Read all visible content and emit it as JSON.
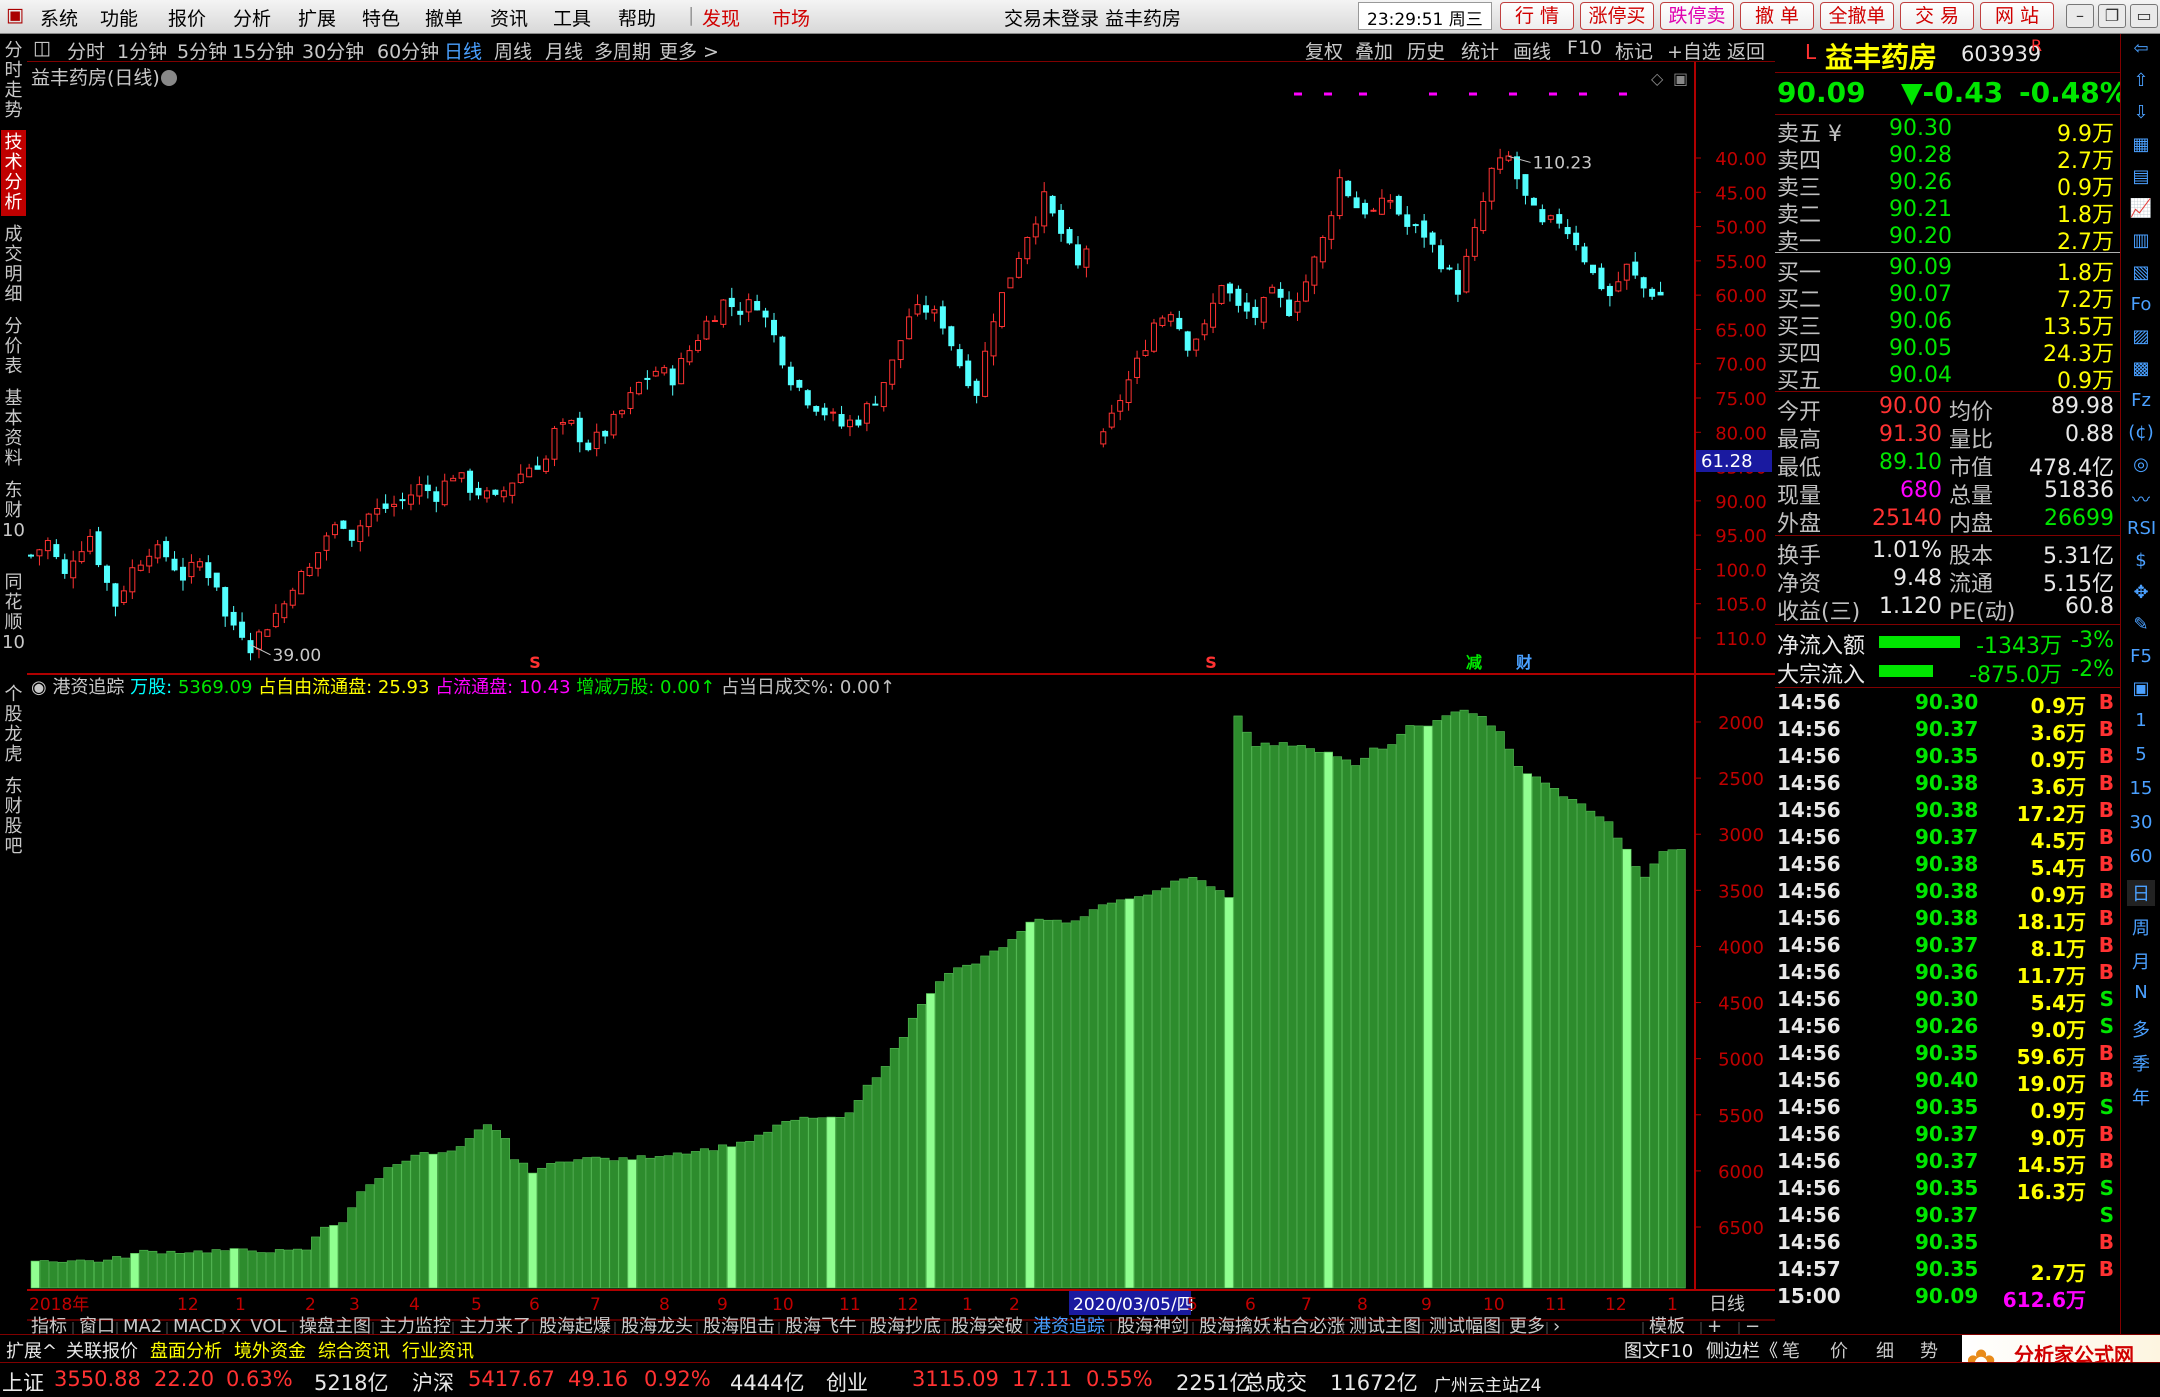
{
  "menu": {
    "items": [
      "系统",
      "功能",
      "报价",
      "分析",
      "扩展",
      "特色",
      "撤单",
      "资讯",
      "工具",
      "帮助"
    ],
    "highlight_items": [
      "发现",
      "市场"
    ],
    "title": "交易未登录  益丰药房",
    "clock": "23:29:51 周三",
    "right_buttons": [
      "行 情",
      "涨停买",
      "跌停卖",
      "撤 单",
      "全撤单",
      "交 易",
      "网 站"
    ]
  },
  "left_tabs": [
    {
      "label": "分时走势",
      "active": false
    },
    {
      "label": "技术分析",
      "active": true
    },
    {
      "label": "成交明细",
      "active": false
    },
    {
      "label": "分价表",
      "active": false
    },
    {
      "label": "基本资料",
      "active": false
    },
    {
      "label": "东财10",
      "active": false
    },
    {
      "label": "同花顺10",
      "active": false
    },
    {
      "label": "个股龙虎",
      "active": false
    },
    {
      "label": "东财股吧",
      "active": false
    }
  ],
  "period_tabs": {
    "items": [
      "分时",
      "1分钟",
      "5分钟",
      "15分钟",
      "30分钟",
      "60分钟",
      "日线",
      "周线",
      "月线",
      "多周期",
      "更多 >"
    ],
    "active": "日线",
    "right_items": [
      "复权",
      "叠加",
      "历史",
      "统计",
      "画线",
      "F10",
      "标记",
      "+自选",
      "返回"
    ]
  },
  "chart": {
    "title": "益丰药房(日线)",
    "high_label": "110.23",
    "low_label": "39.00",
    "cursor_price": "61.28",
    "y_ticks": [
      "110.0",
      "105.0",
      "100.0",
      "95.00",
      "90.00",
      "85.00",
      "80.00",
      "75.00",
      "70.00",
      "65.00",
      "60.00",
      "55.00",
      "50.00",
      "45.00",
      "40.00"
    ],
    "event_marks": [
      {
        "text": "S",
        "color": "#ff3232"
      },
      {
        "text": "S",
        "color": "#ff3232"
      },
      {
        "text": "减",
        "color": "#00e600"
      },
      {
        "text": "财",
        "color": "#4aa0ff"
      }
    ],
    "indicator": {
      "name": "港资追踪",
      "fields": [
        {
          "label": "万股:",
          "value": "5369.09",
          "lc": "#00ffff",
          "vc": "#00e600"
        },
        {
          "label": "占自由流通盘:",
          "value": "25.93",
          "lc": "#ffff00",
          "vc": "#ffff00"
        },
        {
          "label": "占流通盘:",
          "value": "10.43",
          "lc": "#ff00ff",
          "vc": "#ff00ff"
        },
        {
          "label": "增减万股:",
          "value": "0.00",
          "lc": "#00e600",
          "vc": "#00e600"
        },
        {
          "label": "占当日成交%:",
          "value": "0.00",
          "lc": "#c0c0c0",
          "vc": "#c0c0c0"
        }
      ],
      "y_ticks": [
        "6500",
        "6000",
        "5500",
        "5000",
        "4500",
        "4000",
        "3500",
        "3000",
        "2500",
        "2000"
      ]
    },
    "x_labels": [
      "2018年",
      "12",
      "1",
      "2",
      "3",
      "4",
      "5",
      "6",
      "7",
      "8",
      "9",
      "10",
      "11",
      "12",
      "1",
      "2",
      "2020/03/05/四",
      "5",
      "6",
      "7",
      "8",
      "9",
      "10",
      "11",
      "12",
      "1"
    ],
    "x_right_label": "日线"
  },
  "chart_data": [
    {
      "type": "candlestick",
      "title": "益丰药房(日线)",
      "ylim": [
        39,
        111
      ],
      "y_ticks": [
        40,
        45,
        50,
        55,
        60,
        65,
        70,
        75,
        80,
        85,
        90,
        95,
        100,
        105,
        110
      ],
      "close_path": [
        [
          0,
          52
        ],
        [
          2,
          54
        ],
        [
          4,
          49
        ],
        [
          5,
          52
        ],
        [
          7,
          55
        ],
        [
          9,
          48
        ],
        [
          10,
          45
        ],
        [
          12,
          50
        ],
        [
          14,
          53
        ],
        [
          16,
          52
        ],
        [
          18,
          49
        ],
        [
          20,
          51
        ],
        [
          22,
          48
        ],
        [
          23,
          43
        ],
        [
          25,
          41
        ],
        [
          26,
          39
        ],
        [
          28,
          42
        ],
        [
          30,
          45
        ],
        [
          31,
          48
        ],
        [
          33,
          50
        ],
        [
          35,
          55
        ],
        [
          37,
          57
        ],
        [
          38,
          55
        ],
        [
          40,
          58
        ],
        [
          42,
          59
        ],
        [
          44,
          60
        ],
        [
          46,
          62
        ],
        [
          48,
          61
        ],
        [
          50,
          64
        ],
        [
          52,
          62
        ],
        [
          55,
          60
        ],
        [
          57,
          63
        ],
        [
          59,
          65
        ],
        [
          61,
          66
        ],
        [
          62,
          70
        ],
        [
          64,
          71
        ],
        [
          66,
          68
        ],
        [
          68,
          70
        ],
        [
          70,
          73
        ],
        [
          72,
          77
        ],
        [
          74,
          79
        ],
        [
          76,
          78
        ],
        [
          78,
          82
        ],
        [
          80,
          86
        ],
        [
          82,
          89
        ],
        [
          84,
          88
        ],
        [
          86,
          89
        ],
        [
          88,
          84
        ],
        [
          90,
          78
        ],
        [
          92,
          75
        ],
        [
          94,
          73
        ],
        [
          96,
          71
        ],
        [
          98,
          72
        ],
        [
          100,
          75
        ],
        [
          102,
          80
        ],
        [
          104,
          87
        ],
        [
          106,
          88
        ],
        [
          108,
          86
        ],
        [
          110,
          80
        ],
        [
          112,
          76
        ],
        [
          114,
          87
        ],
        [
          116,
          93
        ],
        [
          118,
          99
        ],
        [
          120,
          104
        ],
        [
          122,
          99
        ],
        [
          124,
          94
        ],
        [
          125,
          97
        ]
      ],
      "gap_after_index": 125,
      "close_path_2": [
        [
          127,
          69
        ],
        [
          129,
          75
        ],
        [
          131,
          80
        ],
        [
          133,
          86
        ],
        [
          135,
          88
        ],
        [
          137,
          83
        ],
        [
          139,
          85
        ],
        [
          141,
          92
        ],
        [
          143,
          88
        ],
        [
          145,
          87
        ],
        [
          147,
          90
        ],
        [
          149,
          88
        ],
        [
          151,
          92
        ],
        [
          153,
          98
        ],
        [
          155,
          107
        ],
        [
          157,
          103
        ],
        [
          159,
          102
        ],
        [
          161,
          104
        ],
        [
          163,
          100
        ],
        [
          165,
          99
        ],
        [
          167,
          95
        ],
        [
          169,
          91
        ],
        [
          171,
          99
        ],
        [
          173,
          108
        ],
        [
          175,
          110
        ],
        [
          177,
          104
        ],
        [
          179,
          100
        ],
        [
          181,
          101
        ],
        [
          183,
          98
        ],
        [
          185,
          93
        ],
        [
          187,
          90
        ],
        [
          189,
          94
        ],
        [
          191,
          91
        ],
        [
          193,
          90
        ]
      ],
      "note_high": 110.23,
      "note_low": 39.0
    },
    {
      "type": "bar",
      "title": "港资追踪",
      "series_name": "万股",
      "ylim": [
        1600,
        6750
      ],
      "y_ticks": [
        2000,
        2500,
        3000,
        3500,
        4000,
        4500,
        5000,
        5500,
        6000,
        6500
      ],
      "path": [
        [
          0,
          1700
        ],
        [
          8,
          1700
        ],
        [
          12,
          1780
        ],
        [
          18,
          1780
        ],
        [
          20,
          1790
        ],
        [
          25,
          1790
        ],
        [
          28,
          1780
        ],
        [
          30,
          1800
        ],
        [
          32,
          2000
        ],
        [
          34,
          2050
        ],
        [
          36,
          2300
        ],
        [
          39,
          2520
        ],
        [
          42,
          2650
        ],
        [
          45,
          2650
        ],
        [
          47,
          2700
        ],
        [
          49,
          2850
        ],
        [
          50,
          2900
        ],
        [
          52,
          2800
        ],
        [
          53,
          2600
        ],
        [
          55,
          2500
        ],
        [
          57,
          2550
        ],
        [
          60,
          2620
        ],
        [
          65,
          2600
        ],
        [
          70,
          2650
        ],
        [
          75,
          2700
        ],
        [
          78,
          2750
        ],
        [
          80,
          2800
        ],
        [
          82,
          2900
        ],
        [
          84,
          2950
        ],
        [
          86,
          2980
        ],
        [
          88,
          2960
        ],
        [
          90,
          3000
        ],
        [
          92,
          3250
        ],
        [
          94,
          3450
        ],
        [
          96,
          3700
        ],
        [
          98,
          4000
        ],
        [
          100,
          4200
        ],
        [
          102,
          4300
        ],
        [
          104,
          4350
        ],
        [
          106,
          4450
        ],
        [
          108,
          4550
        ],
        [
          110,
          4700
        ],
        [
          112,
          4750
        ],
        [
          114,
          4700
        ],
        [
          116,
          4780
        ],
        [
          118,
          4870
        ],
        [
          120,
          4900
        ],
        [
          122,
          4950
        ],
        [
          124,
          5000
        ],
        [
          126,
          5080
        ],
        [
          128,
          5100
        ],
        [
          130,
          5050
        ],
        [
          132,
          4950
        ],
        [
          133,
          6550
        ],
        [
          135,
          6300
        ],
        [
          138,
          6300
        ],
        [
          140,
          6300
        ],
        [
          142,
          6250
        ],
        [
          144,
          6200
        ],
        [
          146,
          6100
        ],
        [
          148,
          6250
        ],
        [
          150,
          6300
        ],
        [
          152,
          6450
        ],
        [
          155,
          6500
        ],
        [
          158,
          6620
        ],
        [
          160,
          6550
        ],
        [
          162,
          6400
        ],
        [
          164,
          6100
        ],
        [
          166,
          6000
        ],
        [
          168,
          5900
        ],
        [
          170,
          5800
        ],
        [
          172,
          5720
        ],
        [
          174,
          5600
        ],
        [
          176,
          5350
        ],
        [
          178,
          5100
        ],
        [
          180,
          5350
        ],
        [
          182,
          5370
        ]
      ]
    }
  ],
  "quote": {
    "stock_name": "益丰药房",
    "stock_code": "603939",
    "tag": "R",
    "prefix": "L",
    "price": "90.09",
    "change": "▼-0.43",
    "change_pct": "-0.48%",
    "asks": [
      {
        "label": "卖五",
        "extra": "¥",
        "price": "90.30",
        "vol": "9.9万"
      },
      {
        "label": "卖四",
        "extra": "",
        "price": "90.28",
        "vol": "2.7万"
      },
      {
        "label": "卖三",
        "extra": "",
        "price": "90.26",
        "vol": "0.9万"
      },
      {
        "label": "卖二",
        "extra": "",
        "price": "90.21",
        "vol": "1.8万"
      },
      {
        "label": "卖一",
        "extra": "",
        "price": "90.20",
        "vol": "2.7万"
      }
    ],
    "bids": [
      {
        "label": "买一",
        "price": "90.09",
        "vol": "1.8万"
      },
      {
        "label": "买二",
        "price": "90.07",
        "vol": "7.2万"
      },
      {
        "label": "买三",
        "price": "90.06",
        "vol": "13.5万"
      },
      {
        "label": "买四",
        "price": "90.05",
        "vol": "24.3万"
      },
      {
        "label": "买五",
        "price": "90.04",
        "vol": "0.9万"
      }
    ],
    "stats": [
      {
        "l1": "今开",
        "v1": "90.00",
        "c1": "red",
        "l2": "均价",
        "v2": "89.98",
        "c2": "wht"
      },
      {
        "l1": "最高",
        "v1": "91.30",
        "c1": "red",
        "l2": "量比",
        "v2": "0.88",
        "c2": "wht"
      },
      {
        "l1": "最低",
        "v1": "89.10",
        "c1": "grn",
        "l2": "市值",
        "v2": "478.4亿",
        "c2": "wht"
      },
      {
        "l1": "现量",
        "v1": "680",
        "c1": "mag",
        "l2": "总量",
        "v2": "51836",
        "c2": "wht"
      },
      {
        "l1": "外盘",
        "v1": "25140",
        "c1": "red",
        "l2": "内盘",
        "v2": "26699",
        "c2": "grn"
      }
    ],
    "stats2": [
      {
        "l1": "换手",
        "v1": "1.01%",
        "l2": "股本",
        "v2": "5.31亿"
      },
      {
        "l1": "净资",
        "v1": "9.48",
        "l2": "流通",
        "v2": "5.15亿"
      },
      {
        "l1": "收益(三)",
        "v1": "1.120",
        "l2": "PE(动)",
        "v2": "60.8"
      }
    ],
    "flows": [
      {
        "label": "净流入额",
        "value": "-1343万",
        "pct": "-3%",
        "fill": 0.75
      },
      {
        "label": "大宗流入",
        "value": "-875.0万",
        "pct": "-2%",
        "fill": 0.5
      }
    ],
    "ticks": [
      {
        "t": "14:56",
        "p": "90.30",
        "v": "0.9万",
        "s": "B"
      },
      {
        "t": "14:56",
        "p": "90.37",
        "v": "3.6万",
        "s": "B"
      },
      {
        "t": "14:56",
        "p": "90.35",
        "v": "0.9万",
        "s": "B"
      },
      {
        "t": "14:56",
        "p": "90.38",
        "v": "3.6万",
        "s": "B"
      },
      {
        "t": "14:56",
        "p": "90.38",
        "v": "17.2万",
        "s": "B"
      },
      {
        "t": "14:56",
        "p": "90.37",
        "v": "4.5万",
        "s": "B"
      },
      {
        "t": "14:56",
        "p": "90.38",
        "v": "5.4万",
        "s": "B"
      },
      {
        "t": "14:56",
        "p": "90.38",
        "v": "0.9万",
        "s": "B"
      },
      {
        "t": "14:56",
        "p": "90.38",
        "v": "18.1万",
        "s": "B"
      },
      {
        "t": "14:56",
        "p": "90.37",
        "v": "8.1万",
        "s": "B"
      },
      {
        "t": "14:56",
        "p": "90.36",
        "v": "11.7万",
        "s": "B"
      },
      {
        "t": "14:56",
        "p": "90.30",
        "v": "5.4万",
        "s": "S"
      },
      {
        "t": "14:56",
        "p": "90.26",
        "v": "9.0万",
        "s": "S"
      },
      {
        "t": "14:56",
        "p": "90.35",
        "v": "59.6万",
        "s": "B"
      },
      {
        "t": "14:56",
        "p": "90.40",
        "v": "19.0万",
        "s": "B"
      },
      {
        "t": "14:56",
        "p": "90.35",
        "v": "0.9万",
        "s": "S"
      },
      {
        "t": "14:56",
        "p": "90.37",
        "v": "9.0万",
        "s": "B"
      },
      {
        "t": "14:56",
        "p": "90.37",
        "v": "14.5万",
        "s": "B"
      },
      {
        "t": "14:56",
        "p": "90.35",
        "v": "16.3万",
        "s": "S"
      },
      {
        "t": "14:56",
        "p": "90.37",
        "v": "",
        "s": "S"
      },
      {
        "t": "14:56",
        "p": "90.35",
        "v": "",
        "s": "B"
      },
      {
        "t": "14:57",
        "p": "90.35",
        "v": "2.7万",
        "s": "B"
      },
      {
        "t": "15:00",
        "p": "90.09",
        "v": "612.6万",
        "s": ""
      }
    ]
  },
  "right_tools": [
    "⇦",
    "⇧",
    "⇩",
    "▦",
    "▤",
    "📈",
    "▥",
    "▧",
    "Fo",
    "▨",
    "▩",
    "Fz",
    "(¢)",
    "◎",
    "〰",
    "RSI",
    "$",
    "✥",
    "✎",
    "F5",
    "▣",
    "1",
    "5",
    "15",
    "30",
    "60",
    "日",
    "周",
    "月",
    "N",
    "多",
    "季",
    "年"
  ],
  "indicator_tabs": {
    "items": [
      "指标",
      "窗口",
      "MA2",
      "MACD",
      "X_VOL",
      "操盘主图",
      "主力监控",
      "主力来了",
      "股海起爆",
      "股海龙头",
      "股海阻击",
      "股海飞牛",
      "股海抄底",
      "股海突破",
      "港资追踪",
      "股海神剑",
      "股海擒妖",
      "粘合必涨",
      "测试主图",
      "测试幅图",
      "更多",
      "›",
      "模板",
      "+",
      "−"
    ],
    "active": "港资追踪"
  },
  "bottom_tabs": {
    "items": [
      "扩展^",
      "关联报价",
      "盘面分析",
      "境外资金",
      "综合资讯",
      "行业资讯"
    ],
    "right_items": [
      "图文F10",
      "侧边栏《",
      "笔",
      "价",
      "细",
      "势"
    ]
  },
  "status": {
    "items": [
      {
        "t": "上证",
        "c": "wht"
      },
      {
        "t": "3550.88",
        "c": "red"
      },
      {
        "t": "22.20",
        "c": "red"
      },
      {
        "t": "0.63%",
        "c": "red"
      },
      {
        "t": "5218亿",
        "c": "wht"
      },
      {
        "t": "沪深",
        "c": "wht"
      },
      {
        "t": "5417.67",
        "c": "red"
      },
      {
        "t": "49.16",
        "c": "red"
      },
      {
        "t": "0.92%",
        "c": "red"
      },
      {
        "t": "4444亿",
        "c": "wht"
      },
      {
        "t": "创业",
        "c": "wht"
      },
      {
        "t": "3115.09",
        "c": "red"
      },
      {
        "t": "17.11",
        "c": "red"
      },
      {
        "t": "0.55%",
        "c": "red"
      },
      {
        "t": "2251亿",
        "c": "wht"
      },
      {
        "t": "总成交",
        "c": "wht"
      },
      {
        "t": "11672亿",
        "c": "wht"
      },
      {
        "t": "广州云主站Z4",
        "c": "wht"
      }
    ],
    "logo_text": "分析家公式网",
    "logo_url": "www.70822.com"
  }
}
